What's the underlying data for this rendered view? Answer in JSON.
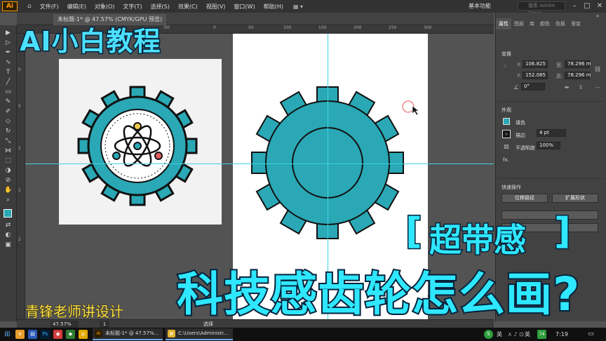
{
  "app": {
    "logo": "Ai"
  },
  "menu": [
    "文件(F)",
    "编辑(E)",
    "对象(O)",
    "文字(T)",
    "选择(S)",
    "效果(C)",
    "视图(V)",
    "窗口(W)",
    "帮助(H)"
  ],
  "header": {
    "workspace": "基本功能",
    "search_placeholder": "搜索 Adobe Stock"
  },
  "document": {
    "tab_title": "未标题-1* @ 47.57% (CMYK/GPU 预览)"
  },
  "ruler": {
    "top_ticks": [
      "-50",
      "0",
      "50",
      "100",
      "150",
      "200",
      "250",
      "300"
    ],
    "left_ticks": [
      "0",
      "5",
      "1",
      "1",
      "2"
    ]
  },
  "panel": {
    "tabs": [
      "属性",
      "图层",
      "库",
      "颜色",
      "色板",
      "渐变"
    ],
    "transform_label": "变换",
    "x": "106.825",
    "y": "152.085",
    "w": "78.296 m",
    "h": "78.296 m",
    "angle": "0°",
    "appearance_label": "外观",
    "fill_label": "填色",
    "stroke_label": "描边",
    "stroke_weight": "4 pt",
    "opacity_label": "不透明度",
    "opacity_value": "100%",
    "fx_label": "fx.",
    "quick_actions_label": "快速操作",
    "btn_offset_path": "位移路径",
    "btn_expand_shape": "扩展形状"
  },
  "status": {
    "zoom": "47.57%",
    "page": "1",
    "tool": "选择"
  },
  "taskbar": {
    "tasks": [
      "未标题-1* @ 47.57%...",
      "C:\\Users\\Administr..."
    ],
    "ime": "英",
    "lang": "英",
    "badge": "74",
    "time": "7:19"
  },
  "overlay": {
    "title": "AI小白教程",
    "bracket_left": "[",
    "highlight": "超带感",
    "bracket_right": "]",
    "question": "科技感齿轮怎么画?",
    "author": "青锋老师讲设计"
  },
  "colors": {
    "teal": "#2aa8b5",
    "accent": "#2fe7ff",
    "author": "#ffe34a",
    "guide": "#3fd3e0"
  }
}
